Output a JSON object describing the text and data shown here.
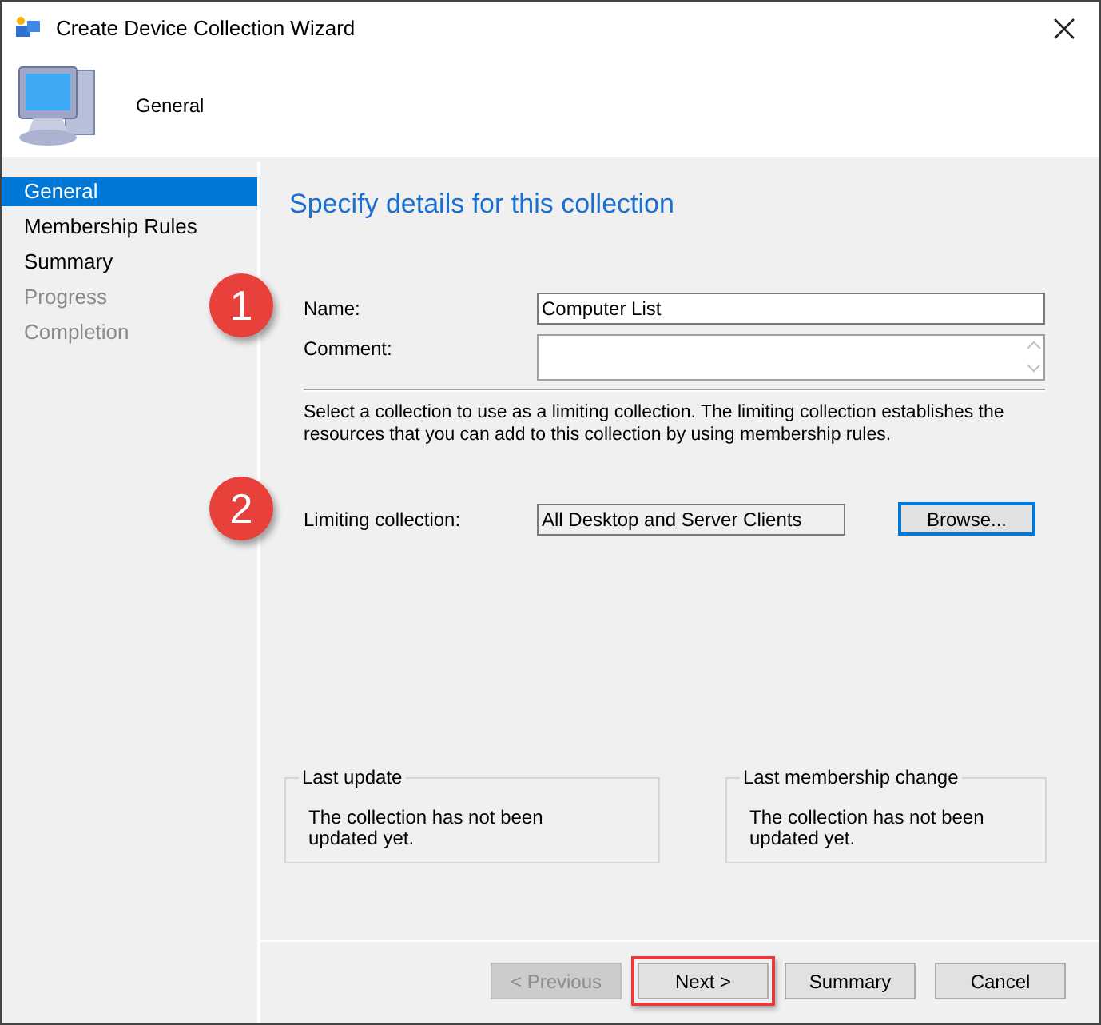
{
  "window": {
    "title": "Create Device Collection Wizard"
  },
  "header": {
    "title": "General"
  },
  "sidebar": {
    "items": [
      {
        "label": "General",
        "selected": true,
        "disabled": false
      },
      {
        "label": "Membership Rules",
        "selected": false,
        "disabled": false
      },
      {
        "label": "Summary",
        "selected": false,
        "disabled": false
      },
      {
        "label": "Progress",
        "selected": false,
        "disabled": true
      },
      {
        "label": "Completion",
        "selected": false,
        "disabled": true
      }
    ]
  },
  "page": {
    "heading": "Specify details for this collection",
    "name": {
      "label": "Name:",
      "value": "Computer List"
    },
    "comment": {
      "label": "Comment:"
    },
    "description": "Select a collection to use as a limiting collection. The limiting collection establishes the resources that you can add to this collection by using membership rules.",
    "limiting": {
      "label": "Limiting collection:",
      "value": "All Desktop and Server Clients",
      "button": "Browse..."
    },
    "groups": [
      {
        "title": "Last update",
        "text": "The collection has not been updated yet."
      },
      {
        "title": "Last membership change",
        "text": "The collection has not been updated yet."
      }
    ]
  },
  "callouts": [
    "1",
    "2"
  ],
  "buttons": [
    {
      "label": "< Previous",
      "disabled": true,
      "highlighted": false
    },
    {
      "label": "Next >",
      "disabled": false,
      "highlighted": true
    },
    {
      "label": "Summary",
      "disabled": false,
      "highlighted": false
    },
    {
      "label": "Cancel",
      "disabled": false,
      "highlighted": false
    }
  ]
}
